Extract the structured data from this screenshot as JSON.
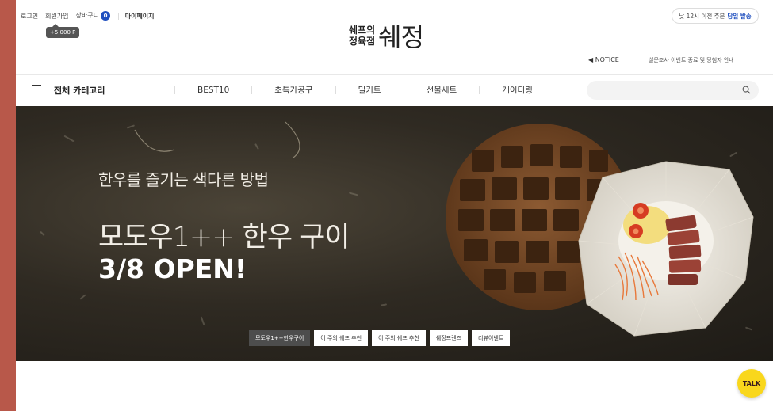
{
  "utility": {
    "login": "로그인",
    "signup": "회원가입",
    "cart": "장바구니",
    "cart_count": "0",
    "mypage": "마이페이지",
    "point_tooltip": "+5,000 P"
  },
  "logo": {
    "line1": "쉐프의",
    "line2": "정육점",
    "big": "쉐정"
  },
  "delivery": {
    "text": "낮 12시 이전 주문",
    "highlight": "당일 발송"
  },
  "notice": {
    "label": "◀ NOTICE",
    "text": "설문조사 이벤트 종료 및 당첨자 안내"
  },
  "nav": {
    "all_categories": "전체 카테고리",
    "items": [
      "BEST10",
      "초특가공구",
      "밀키트",
      "선물세트",
      "케이터링"
    ],
    "search_placeholder": ""
  },
  "hero": {
    "subtitle": "한우를 즐기는 색다른 방법",
    "title": "모도우1++ 한우 구이",
    "open": "3/8 OPEN!"
  },
  "banner_tabs": [
    {
      "label": "모도우1++한우구이",
      "active": true
    },
    {
      "label": "이 주의 쉐프 추천",
      "active": false
    },
    {
      "label": "이 주의 쉐프 추천",
      "active": false
    },
    {
      "label": "쉐정프렌즈",
      "active": false
    },
    {
      "label": "리뷰이벤트",
      "active": false
    }
  ],
  "chat": {
    "label": "TALK"
  },
  "colors": {
    "accent": "#1f4fbf",
    "kakao": "#f9d71c",
    "frame": "#b8584a"
  }
}
